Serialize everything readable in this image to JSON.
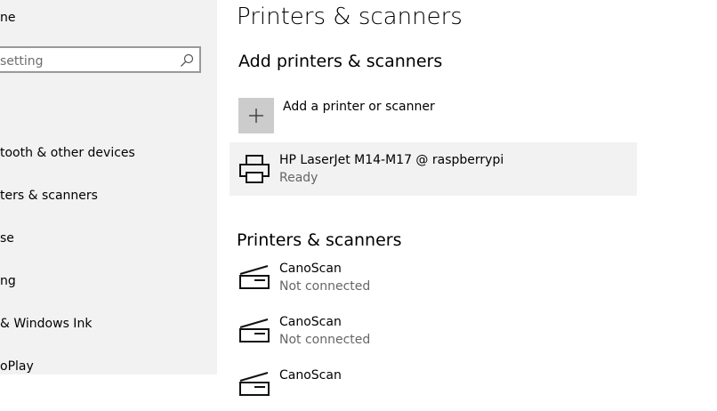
{
  "sidebar": {
    "home_label": "ne",
    "search_placeholder": "setting",
    "items": [
      {
        "label": "tooth & other devices"
      },
      {
        "label": "ters & scanners"
      },
      {
        "label": "se"
      },
      {
        "label": "ng"
      },
      {
        "label": "& Windows Ink"
      },
      {
        "label": "oPlay"
      }
    ]
  },
  "main": {
    "page_title": "Printers & scanners",
    "add_section_title": "Add printers & scanners",
    "add_button_label": "Add a printer or scanner",
    "selected_device": {
      "name": "HP LaserJet M14-M17 @ raspberrypi",
      "status": "Ready",
      "icon": "printer-icon"
    },
    "list_section_title": "Printers & scanners",
    "devices": [
      {
        "name": "CanoScan",
        "status": "Not connected",
        "icon": "scanner-icon"
      },
      {
        "name": "CanoScan",
        "status": "Not connected",
        "icon": "scanner-icon"
      },
      {
        "name": "CanoScan",
        "status": "",
        "icon": "scanner-icon"
      }
    ]
  }
}
